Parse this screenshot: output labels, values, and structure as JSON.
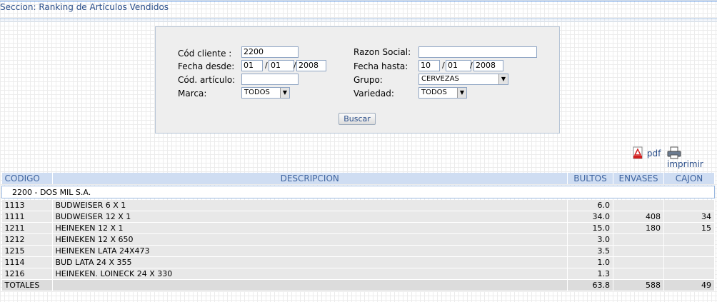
{
  "section": {
    "title": "Seccion: Ranking de Artículos Vendidos"
  },
  "filters": {
    "cliente_label": "Cód cliente :",
    "cliente_value": "2200",
    "razon_label": "Razon Social:",
    "razon_value": "",
    "desde_label": "Fecha desde:",
    "desde_dd": "01",
    "desde_mm": "01",
    "desde_yyyy": "2008",
    "hasta_label": "Fecha hasta:",
    "hasta_dd": "10",
    "hasta_mm": "01",
    "hasta_yyyy": "2008",
    "articulo_label": "Cód. artículo:",
    "articulo_value": "",
    "grupo_label": "Grupo:",
    "grupo_value": "CERVEZAS",
    "marca_label": "Marca:",
    "marca_value": "TODOS",
    "variedad_label": "Variedad:",
    "variedad_value": "TODOS",
    "slash": "/",
    "buscar_label": "Buscar"
  },
  "actions": {
    "pdf_label": "pdf",
    "print_label": "imprimir"
  },
  "table": {
    "headers": [
      "CODIGO",
      "DESCRIPCION",
      "BULTOS",
      "ENVASES",
      "CAJON"
    ],
    "group_label": "2200 - DOS MIL S.A.",
    "rows": [
      [
        "1113",
        "BUDWEISER 6 X 1",
        "6.0",
        "",
        ""
      ],
      [
        "1111",
        "BUDWEISER 12 X 1",
        "34.0",
        "408",
        "34"
      ],
      [
        "1211",
        "HEINEKEN 12 X 1",
        "15.0",
        "180",
        "15"
      ],
      [
        "1212",
        "HEINEKEN 12 X 650",
        "3.0",
        "",
        ""
      ],
      [
        "1215",
        "HEINEKEN LATA 24X473",
        "3.5",
        "",
        ""
      ],
      [
        "1114",
        "BUD LATA 24 X 355",
        "1.0",
        "",
        ""
      ],
      [
        "1216",
        "HEINEKEN. LOINECK 24 X 330",
        "1.3",
        "",
        ""
      ]
    ],
    "totals": [
      "TOTALES",
      "",
      "63.8",
      "588",
      "49"
    ]
  }
}
